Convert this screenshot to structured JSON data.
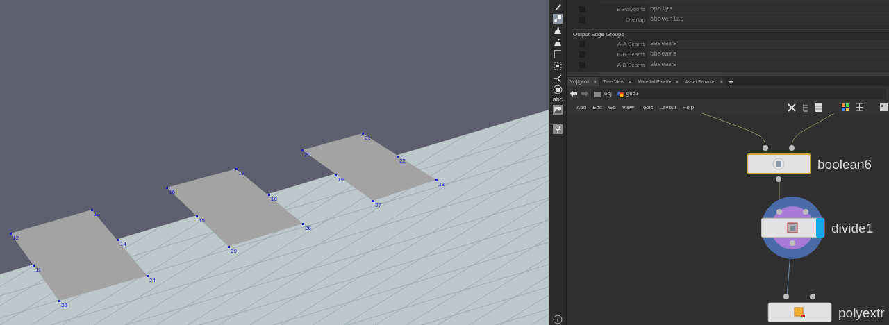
{
  "viewport": {
    "planes": [
      {
        "points": [
          "12",
          "13",
          "14",
          "11",
          "24",
          "25"
        ]
      },
      {
        "points": [
          "16",
          "17",
          "18",
          "15",
          "26",
          "29"
        ]
      },
      {
        "points": [
          "20",
          "21",
          "22",
          "19",
          "28",
          "27"
        ]
      }
    ]
  },
  "toolbar": {
    "text_tool": "abc"
  },
  "parameters": {
    "rows": [
      {
        "label": "B Polygons",
        "value": "bpolys",
        "checked": false
      },
      {
        "label": "Overlap",
        "value": "aboverlap",
        "checked": false
      }
    ],
    "section_title": "Output Edge Groups",
    "edge_rows": [
      {
        "label": "A-A Seams",
        "value": "aaseams",
        "checked": false
      },
      {
        "label": "B-B Seams",
        "value": "bbseams",
        "checked": false
      },
      {
        "label": "A-B Seams",
        "value": "abseams",
        "checked": false
      }
    ]
  },
  "tabs": [
    {
      "label": "/obj/geo1",
      "selected": true
    },
    {
      "label": "Tree View",
      "selected": false
    },
    {
      "label": "Material Palette",
      "selected": false
    },
    {
      "label": "Asset Browser",
      "selected": false
    }
  ],
  "tab_close": "×",
  "tab_add": "+",
  "path": [
    "obj",
    "geo1"
  ],
  "menu": [
    "Add",
    "Edit",
    "Go",
    "View",
    "Tools",
    "Layout",
    "Help"
  ],
  "nodes": [
    {
      "name": "boolean6",
      "kind": "boolean",
      "selected": true,
      "display_flag": false
    },
    {
      "name": "divide1",
      "kind": "divide",
      "selected": false,
      "display_flag": true
    },
    {
      "name": "polyextr",
      "kind": "polyextrude",
      "selected": false,
      "display_flag": false
    }
  ]
}
